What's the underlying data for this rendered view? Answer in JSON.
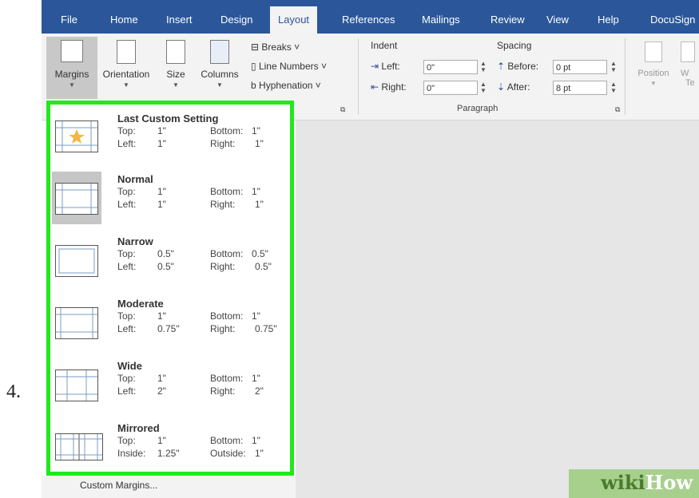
{
  "step": "4.",
  "tabs": [
    "File",
    "Home",
    "Insert",
    "Design",
    "Layout",
    "References",
    "Mailings",
    "Review",
    "View",
    "Help",
    "DocuSign"
  ],
  "active_tab": "Layout",
  "ribbon": {
    "margins": "Margins",
    "orientation": "Orientation",
    "size": "Size",
    "columns": "Columns",
    "breaks": "Breaks ˅",
    "line_numbers": "Line Numbers ˅",
    "hyphenation": "Hyphenation ˅",
    "indent_title": "Indent",
    "spacing_title": "Spacing",
    "left_label": "Left:",
    "left_value": "0\"",
    "right_label": "Right:",
    "right_value": "0\"",
    "before_label": "Before:",
    "before_value": "0 pt",
    "after_label": "After:",
    "after_value": "8 pt",
    "paragraph_group": "Paragraph",
    "position": "Position",
    "wrap_partial": "W",
    "wrap_partial2": "Te"
  },
  "margin_options": [
    {
      "title": "Last Custom Setting",
      "r1k": "Top:",
      "r1v": "1\"",
      "r1k2": "Bottom:",
      "r1v2": "1\"",
      "r2k": "Left:",
      "r2v": "1\"",
      "r2k2": "Right:",
      "r2v2": "1\""
    },
    {
      "title": "Normal",
      "r1k": "Top:",
      "r1v": "1\"",
      "r1k2": "Bottom:",
      "r1v2": "1\"",
      "r2k": "Left:",
      "r2v": "1\"",
      "r2k2": "Right:",
      "r2v2": "1\""
    },
    {
      "title": "Narrow",
      "r1k": "Top:",
      "r1v": "0.5\"",
      "r1k2": "Bottom:",
      "r1v2": "0.5\"",
      "r2k": "Left:",
      "r2v": "0.5\"",
      "r2k2": "Right:",
      "r2v2": "0.5\""
    },
    {
      "title": "Moderate",
      "r1k": "Top:",
      "r1v": "1\"",
      "r1k2": "Bottom:",
      "r1v2": "1\"",
      "r2k": "Left:",
      "r2v": "0.75\"",
      "r2k2": "Right:",
      "r2v2": "0.75\""
    },
    {
      "title": "Wide",
      "r1k": "Top:",
      "r1v": "1\"",
      "r1k2": "Bottom:",
      "r1v2": "1\"",
      "r2k": "Left:",
      "r2v": "2\"",
      "r2k2": "Right:",
      "r2v2": "2\""
    },
    {
      "title": "Mirrored",
      "r1k": "Top:",
      "r1v": "1\"",
      "r1k2": "Bottom:",
      "r1v2": "1\"",
      "r2k": "Inside:",
      "r2v": "1.25\"",
      "r2k2": "Outside:",
      "r2v2": "1\""
    }
  ],
  "custom_margins": "Custom Margins...",
  "watermark": {
    "wiki": "wiki",
    "how": "How"
  },
  "colors": {
    "ribbon_blue": "#2b579a",
    "highlight_green": "#22e81c"
  }
}
